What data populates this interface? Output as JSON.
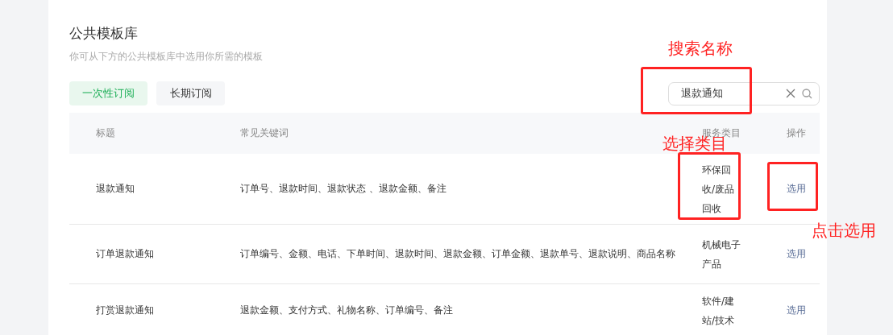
{
  "header": {
    "title": "公共模板库",
    "subtitle": "你可从下方的公共模板库中选用你所需的模板"
  },
  "tabs": [
    {
      "label": "一次性订阅",
      "selected": true
    },
    {
      "label": "长期订阅",
      "selected": false
    }
  ],
  "search": {
    "value": "退款通知"
  },
  "table": {
    "columns": [
      "标题",
      "常见关键词",
      "服务类目",
      "操作"
    ],
    "rows": [
      {
        "title": "退款通知",
        "keywords": "订单号、退款时间、退款状态 、退款金额、备注",
        "category_lines": [
          "环保回",
          "收/废品",
          "回收"
        ],
        "action": "选用"
      },
      {
        "title": "订单退款通知",
        "keywords": "订单编号、金额、电话、下单时间、退款时间、退款金额、订单金额、退款单号、退款说明、商品名称",
        "category_lines": [
          "机械电子",
          "产品"
        ],
        "action": "选用"
      },
      {
        "title": "打赏退款通知",
        "keywords": "退款金额、支付方式、礼物名称、订单编号、备注",
        "category_lines": [
          "软件/建",
          "站/技术"
        ],
        "action": "选用"
      }
    ]
  },
  "annotations": [
    {
      "label": "搜索名称"
    },
    {
      "label": "选择类目"
    },
    {
      "label": "点击选用"
    }
  ]
}
